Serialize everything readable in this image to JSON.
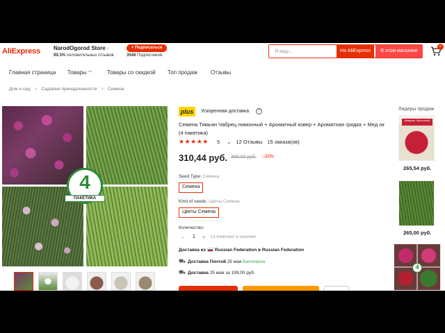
{
  "header": {
    "logo": "AliExpress",
    "store_name": "NarodOgorod Store",
    "store_rating_value": "99.3%",
    "store_rating_text": "положительных отзывов",
    "subscribe_label": "+ Подписаться",
    "subscribers_count": "3548",
    "subscribers_text": "Подписчиков",
    "search_placeholder": "Я ищу...",
    "search_aliexpress_label": "На AliExpress",
    "search_store_label": "В этом магазине",
    "cart_count": "0"
  },
  "nav": [
    {
      "label": "Главная страница"
    },
    {
      "label": "Товары"
    },
    {
      "label": "Товары со скидкой"
    },
    {
      "label": "Топ продаж"
    },
    {
      "label": "Отзывы"
    }
  ],
  "breadcrumbs": [
    "Дом и сад",
    "Садовые принадлежности",
    "Семена"
  ],
  "gallery": {
    "badge_number": "4",
    "badge_label": "ПАКЕТИКА"
  },
  "product": {
    "plus_logo": "plus",
    "plus_text": "Ускоренная доставка",
    "title": "Семена Тимьян Чабрец лимонный + Ароматный ковер + Ароматная грядка + Мед ок (4 пакетика)",
    "stars": "★★★★★",
    "rating": "5",
    "reviews": "12 Отзывы",
    "orders": "15 заказа(ов)",
    "price": "310,44 руб.",
    "old_price": "398,00 руб.",
    "discount": "-22%",
    "option1_label": "Seed Type:",
    "option1_value": "Семена",
    "option1_selected": "Семена",
    "option2_label": "Kind of seeds:",
    "option2_value": "Цветы Семена",
    "option2_selected": "Цветы Семена",
    "quantity_label": "Количество:",
    "quantity": "1",
    "stock_text": "13 Комплект в наличии",
    "shipping_from_prefix": "Доставка из",
    "shipping_from": "Russian Federation в Russian Federation",
    "delivery_method": "Доставка Почтой",
    "delivery_date": "25 мая",
    "delivery_free": "Бесплатно",
    "delivery2_method": "Доставка",
    "delivery2_text": "25 мая за 199,00 руб."
  },
  "sidebar": {
    "title": "Лидеры продаж",
    "item1_label": "Амарант Хвостатый",
    "items": [
      {
        "price": "265,54 руб."
      },
      {
        "price": "265,00 руб."
      }
    ],
    "item3_badge": "4"
  }
}
